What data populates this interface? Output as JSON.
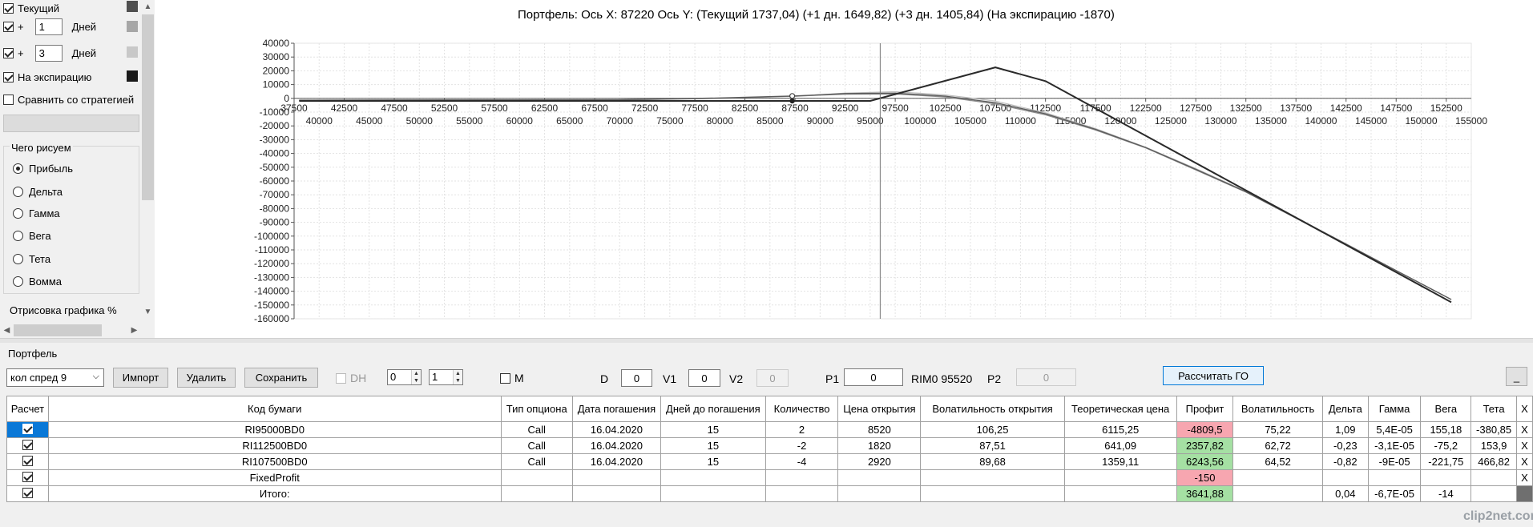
{
  "left_panel": {
    "current": {
      "label": "Текущий",
      "checked": true,
      "color": "#4f4f4f"
    },
    "day1": {
      "prefix": "+",
      "value": "1",
      "unit": "Дней",
      "checked": true,
      "color": "#a6a6a6"
    },
    "day3": {
      "prefix": "+",
      "value": "3",
      "unit": "Дней",
      "checked": true,
      "color": "#c8c8c8"
    },
    "expiry": {
      "label": "На экспирацию",
      "checked": true,
      "color": "#1a1a1a"
    },
    "compare": {
      "label": "Сравнить со стратегией",
      "checked": false
    },
    "draw_group_label": "Чего рисуем",
    "draw_options": [
      "Прибыль",
      "Дельта",
      "Гамма",
      "Вега",
      "Тета",
      "Вомма"
    ],
    "draw_selected": "Прибыль",
    "render_label": "Отрисовка графика %"
  },
  "chart_data": {
    "type": "line",
    "title": "Портфель: Ось X: 87220 Ось Y:  (Текущий 1737,04)  (+1 дн. 1649,82)  (+3 дн. 1405,84)  (На экспирацию -1870)",
    "xlim": [
      37500,
      155000
    ],
    "ylim": [
      -160000,
      40000
    ],
    "y_ticks": [
      40000,
      30000,
      20000,
      10000,
      0,
      -10000,
      -20000,
      -30000,
      -40000,
      -50000,
      -60000,
      -70000,
      -80000,
      -90000,
      -100000,
      -110000,
      -120000,
      -130000,
      -140000,
      -150000,
      -160000
    ],
    "x_ticks_upper": [
      37500,
      42500,
      47500,
      52500,
      57500,
      62500,
      67500,
      72500,
      77500,
      82500,
      87500,
      92500,
      97500,
      102500,
      107500,
      112500,
      117500,
      122500,
      127500,
      132500,
      137500,
      142500,
      147500,
      152500
    ],
    "x_ticks_lower": [
      40000,
      45000,
      50000,
      55000,
      60000,
      65000,
      70000,
      75000,
      80000,
      85000,
      90000,
      95000,
      100000,
      105000,
      110000,
      115000,
      120000,
      125000,
      130000,
      135000,
      140000,
      145000,
      150000,
      155000
    ],
    "crosshair_x": 96000,
    "marker_x": 87220,
    "grid": true,
    "series": [
      {
        "color": "#2a2a2a",
        "width": 2,
        "x": [
          38000,
          95000,
          107500,
          112500,
          153000
        ],
        "y": [
          -1870,
          -1870,
          22500,
          12500,
          -148000
        ]
      },
      {
        "color": "#8c8c8c",
        "width": 1.3,
        "x": [
          38000,
          70000,
          80000,
          87500,
          92500,
          97500,
          102500,
          107500,
          112500,
          117500,
          122500,
          127500,
          132500,
          137500,
          142500,
          147500,
          153000
        ],
        "y": [
          -1400,
          -1100,
          0,
          1650,
          3000,
          3200,
          1000,
          -4000,
          -12000,
          -23000,
          -36000,
          -52000,
          -68000,
          -87000,
          -106000,
          -125000,
          -146000
        ]
      },
      {
        "color": "#bdbdbd",
        "width": 1.3,
        "x": [
          38000,
          70000,
          80000,
          87500,
          92500,
          97500,
          102500,
          107500,
          112500,
          117500,
          122500,
          127500,
          132500,
          137500,
          142500,
          147500,
          153000
        ],
        "y": [
          -1500,
          -1200,
          200,
          1400,
          3800,
          4800,
          2500,
          -2000,
          -10500,
          -22000,
          -35500,
          -51000,
          -67500,
          -86500,
          -105500,
          -125000,
          -146000
        ]
      },
      {
        "color": "#5a5a5a",
        "width": 1.3,
        "x": [
          38000,
          70000,
          80000,
          87500,
          92500,
          97500,
          102500,
          107500,
          112500,
          117500,
          122500,
          127500,
          132500,
          137500,
          142500,
          147500,
          153000
        ],
        "y": [
          -1300,
          -1000,
          300,
          1740,
          3500,
          3800,
          1600,
          -3200,
          -11200,
          -22500,
          -35700,
          -51500,
          -67800,
          -86800,
          -105800,
          -125000,
          -146000
        ]
      }
    ]
  },
  "portfolio": {
    "label": "Портфель",
    "strategy_select": "кол спред 9",
    "import_label": "Импорт",
    "delete_label": "Удалить",
    "save_label": "Сохранить",
    "dh_label": "DH",
    "spin1": "0",
    "spin2": "1",
    "m_label": "M",
    "d_label": "D",
    "d_value": "0",
    "v1_label": "V1",
    "v1_value": "0",
    "v2_label": "V2",
    "v2_value": "0",
    "p1_label": "P1",
    "p1_value": "0",
    "rim_label": "RIM0 95520",
    "p2_label": "P2",
    "p2_value": "0",
    "calc_go_label": "Рассчитать ГО",
    "minimize_label": "_"
  },
  "table": {
    "headers": [
      "Расчет",
      "Код бумаги",
      "Тип опциона",
      "Дата погашения",
      "Дней до погашения",
      "Количество",
      "Цена открытия",
      "Волатильность открытия",
      "Теоретическая цена",
      "Профит",
      "Волатильность",
      "Дельта",
      "Гамма",
      "Вега",
      "Тета",
      "X"
    ],
    "rows": [
      [
        "",
        "RI95000BD0",
        "Call",
        "16.04.2020",
        "15",
        "2",
        "8520",
        "106,25",
        "6115,25",
        "-4809,5",
        "75,22",
        "1,09",
        "5,4E-05",
        "155,18",
        "-380,85",
        "X"
      ],
      [
        "",
        "RI112500BD0",
        "Call",
        "16.04.2020",
        "15",
        "-2",
        "1820",
        "87,51",
        "641,09",
        "2357,82",
        "62,72",
        "-0,23",
        "-3,1E-05",
        "-75,2",
        "153,9",
        "X"
      ],
      [
        "",
        "RI107500BD0",
        "Call",
        "16.04.2020",
        "15",
        "-4",
        "2920",
        "89,68",
        "1359,11",
        "6243,56",
        "64,52",
        "-0,82",
        "-9E-05",
        "-221,75",
        "466,82",
        "X"
      ],
      [
        "",
        "FixedProfit",
        "",
        "",
        "",
        "",
        "",
        "",
        "",
        "-150",
        "",
        "",
        "",
        "",
        "",
        "X"
      ],
      [
        "",
        "Итого:",
        "",
        "",
        "",
        "",
        "",
        "",
        "",
        "3641,88",
        "",
        "0,04",
        "-6,7E-05",
        "-14",
        "",
        ""
      ]
    ],
    "profit_colors": {
      "negative": "#f7a6b0",
      "positive": "#a5e0a3"
    }
  },
  "watermark": "clip2net.com"
}
